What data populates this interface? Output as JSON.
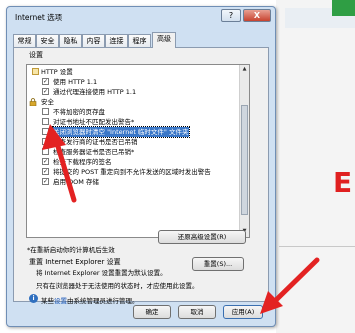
{
  "window": {
    "title": "Internet 选项",
    "help_label": "?",
    "close_label": "X"
  },
  "tabs": [
    {
      "label": "常规"
    },
    {
      "label": "安全"
    },
    {
      "label": "隐私"
    },
    {
      "label": "内容"
    },
    {
      "label": "连接"
    },
    {
      "label": "程序"
    },
    {
      "label": "高级"
    }
  ],
  "settings": {
    "heading": "设置",
    "items": [
      {
        "label": "HTTP 设置",
        "type": "folder"
      },
      {
        "label": "使用 HTTP 1.1",
        "type": "check",
        "checked": true
      },
      {
        "label": "通过代理连接使用 HTTP 1.1",
        "type": "check",
        "checked": true
      },
      {
        "label": "安全",
        "type": "lock"
      },
      {
        "label": "不将加密的页存盘",
        "type": "check",
        "checked": false
      },
      {
        "label": "对证书地址不匹配发出警告*",
        "type": "check",
        "checked": false
      },
      {
        "label": "关闭浏览器时清空 \"Internet 临时文件\" 文件夹",
        "type": "check",
        "checked": false,
        "highlighted": true
      },
      {
        "label": "检查发行商的证书是否已吊销",
        "type": "check",
        "checked": false
      },
      {
        "label": "检查服务器证书是否已吊销*",
        "type": "check",
        "checked": false
      },
      {
        "label": "检查下载程序的签名",
        "type": "check",
        "checked": true
      },
      {
        "label": "将提交的 POST 重定向到不允许发送的区域时发出警告",
        "type": "check",
        "checked": true
      },
      {
        "label": "启用 DOM 存储",
        "type": "check",
        "checked": true
      }
    ],
    "restart_note": "*在重新启动你的计算机后生效",
    "restore_button": "还原高级设置(R)"
  },
  "reset": {
    "heading": "重置 Internet Explorer 设置",
    "description": "将 Internet Explorer 设置重置为默认设置。",
    "button": "重置(S)...",
    "note": "只有在浏览器处于无法使用的状态时，才应使用此设置。"
  },
  "info": {
    "prefix": "某些",
    "link": "设置",
    "suffix": "由系统管理员进行管理。"
  },
  "footer": {
    "ok": "确定",
    "cancel": "取消",
    "apply": "应用(A)"
  },
  "background": {
    "letter": "E"
  },
  "colors": {
    "arrow": "#e32222",
    "highlight": "#3a77c8"
  }
}
